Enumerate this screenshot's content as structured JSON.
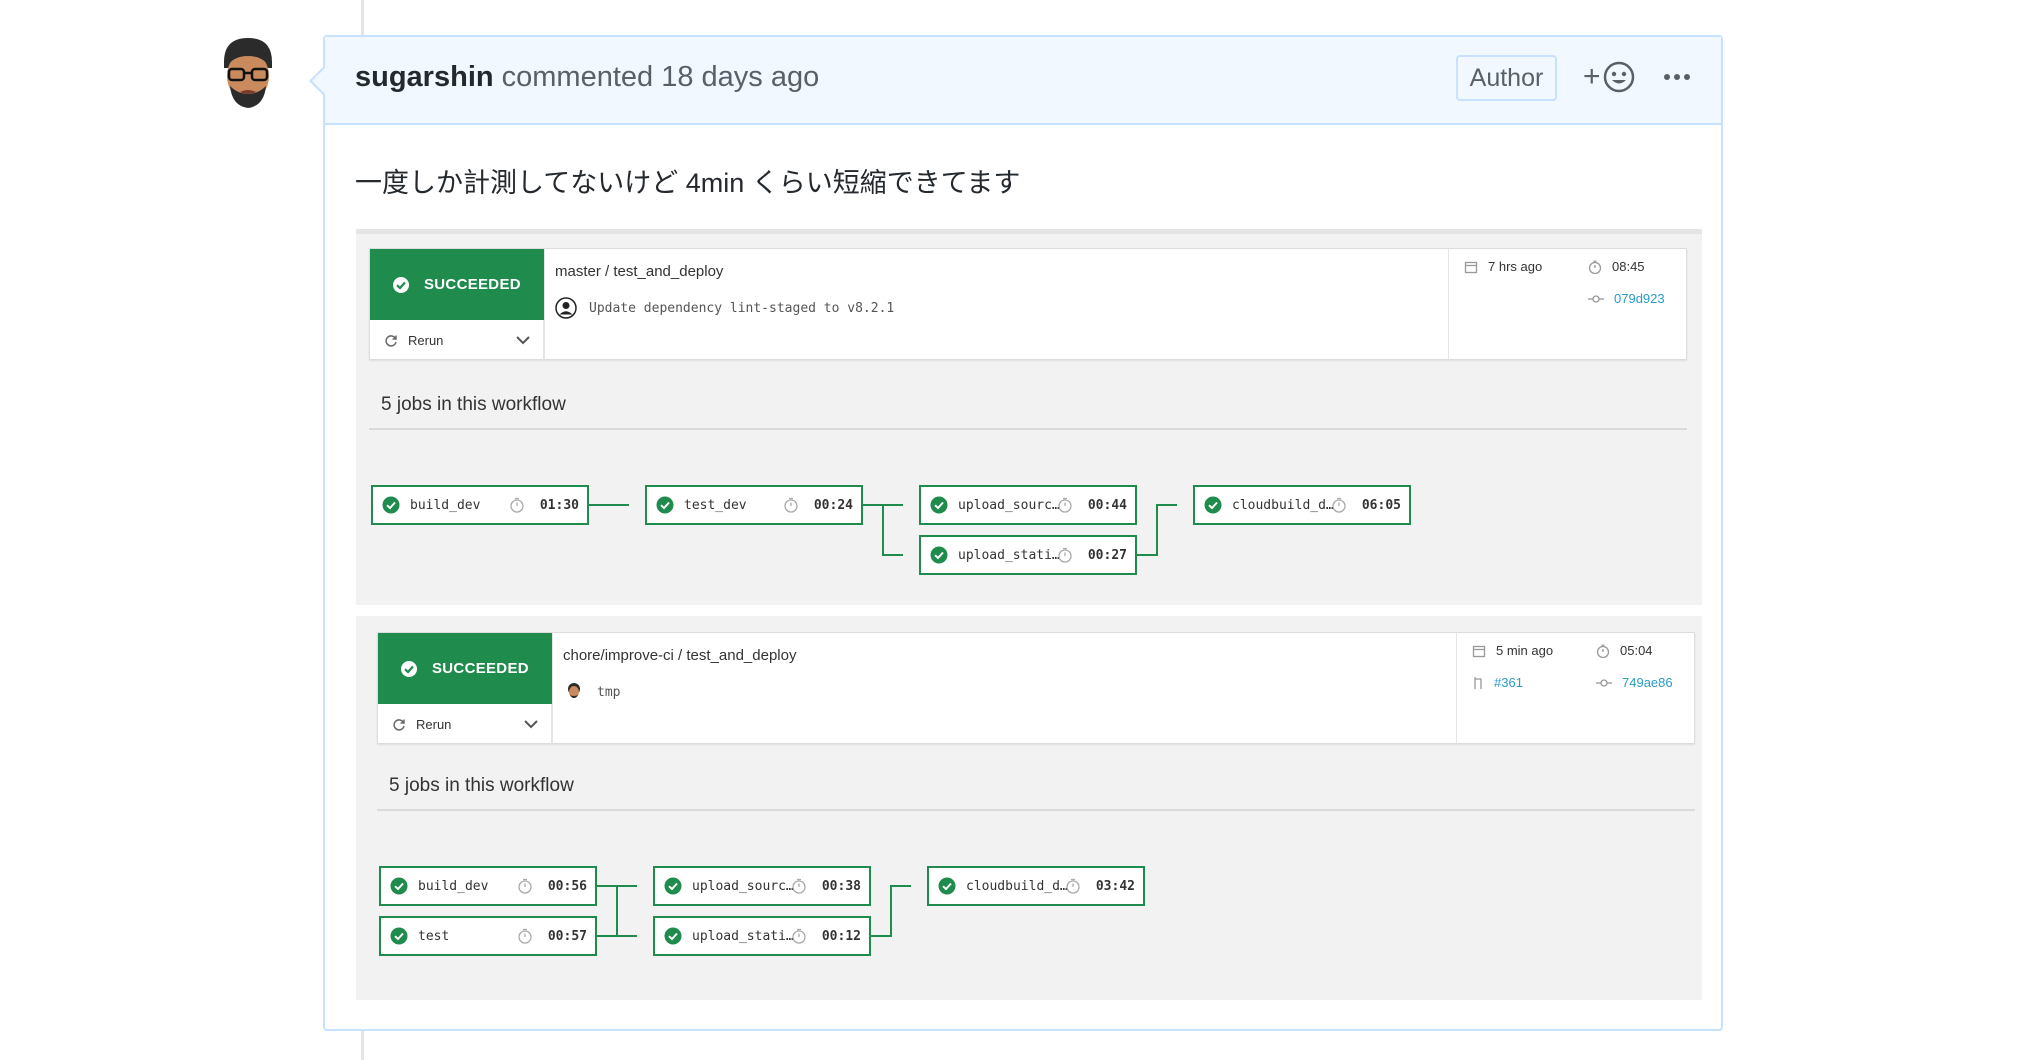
{
  "comment": {
    "author": "sugarshin",
    "action_text": " commented 18 days ago",
    "badge": "Author",
    "reaction_plus": "+",
    "body": "一度しか計測してないけど 4min くらい短縮できてます"
  },
  "colors": {
    "success": "#1f8b4c",
    "header_bg": "#f1f8ff",
    "header_border": "#c8e1ff",
    "link": "#2a9bc8"
  },
  "workflows": [
    {
      "status": "SUCCEEDED",
      "rerun_label": "Rerun",
      "title": "master / test_and_deploy",
      "commit_message": "Update dependency lint-staged to v8.2.1",
      "time_ago": "7 hrs ago",
      "duration": "08:45",
      "commit_hash": "079d923",
      "jobs_title": "5 jobs in this workflow",
      "jobs": [
        {
          "name": "build_dev",
          "duration": "01:30"
        },
        {
          "name": "test_dev",
          "duration": "00:24"
        },
        {
          "name": "upload_sourc…",
          "duration": "00:44"
        },
        {
          "name": "upload_stati…",
          "duration": "00:27"
        },
        {
          "name": "cloudbuild_d…",
          "duration": "06:05"
        }
      ]
    },
    {
      "status": "SUCCEEDED",
      "rerun_label": "Rerun",
      "title": "chore/improve-ci / test_and_deploy",
      "commit_message": "tmp",
      "time_ago": "5 min ago",
      "duration": "05:04",
      "pr_number": "#361",
      "commit_hash": "749ae86",
      "jobs_title": "5 jobs in this workflow",
      "jobs": [
        {
          "name": "build_dev",
          "duration": "00:56"
        },
        {
          "name": "test",
          "duration": "00:57"
        },
        {
          "name": "upload_sourc…",
          "duration": "00:38"
        },
        {
          "name": "upload_stati…",
          "duration": "00:12"
        },
        {
          "name": "cloudbuild_d…",
          "duration": "03:42"
        }
      ]
    }
  ]
}
